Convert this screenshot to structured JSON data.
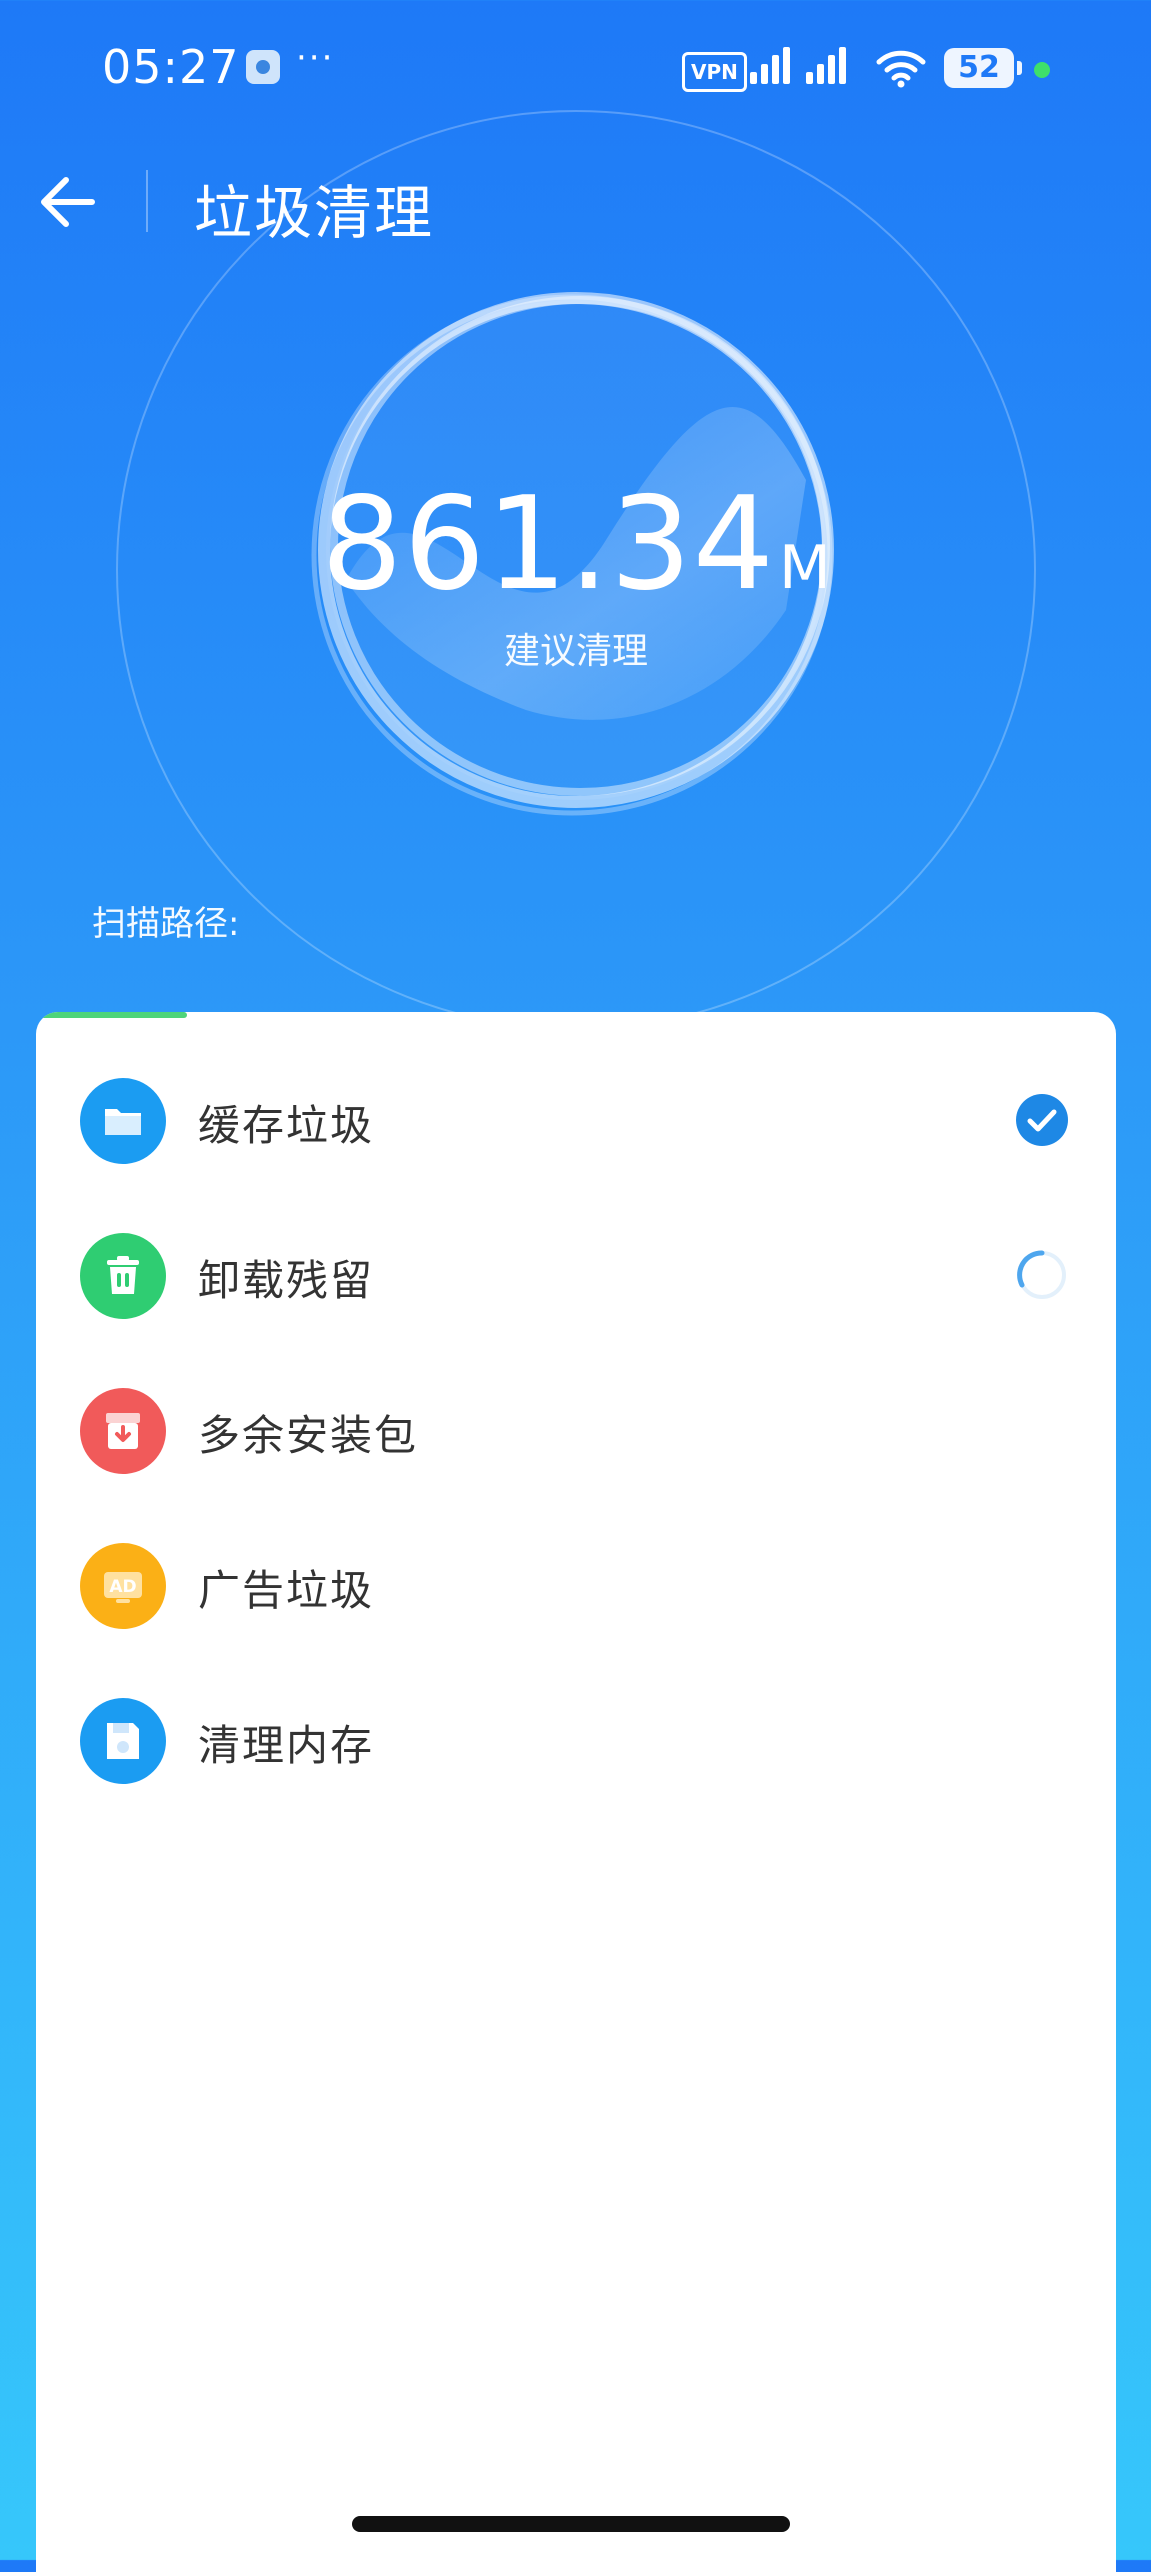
{
  "status_bar": {
    "time": "05:27",
    "more": "···",
    "vpn": "VPN",
    "battery": "52"
  },
  "header": {
    "title": "垃圾清理"
  },
  "hero": {
    "size_value": "861.34",
    "size_unit": "M",
    "hint": "建议清理"
  },
  "scan": {
    "label": "扫描路径:"
  },
  "scan_progress": 0.14,
  "items": [
    {
      "label": "缓存垃圾",
      "icon": "folder-icon",
      "color": "#1b9cf2",
      "status": "done"
    },
    {
      "label": "卸载残留",
      "icon": "trash-icon",
      "color": "#2fcd72",
      "status": "scanning"
    },
    {
      "label": "多余安装包",
      "icon": "package-icon",
      "color": "#f15a5a",
      "status": "pending"
    },
    {
      "label": "广告垃圾",
      "icon": "ad-icon",
      "color": "#fbb016",
      "status": "pending"
    },
    {
      "label": "清理内存",
      "icon": "memory-icon",
      "color": "#1b9cf2",
      "status": "pending"
    }
  ],
  "colors": {
    "accent": "#1e79f7",
    "check": "#1e88e5",
    "progress": "#4ed47a"
  }
}
